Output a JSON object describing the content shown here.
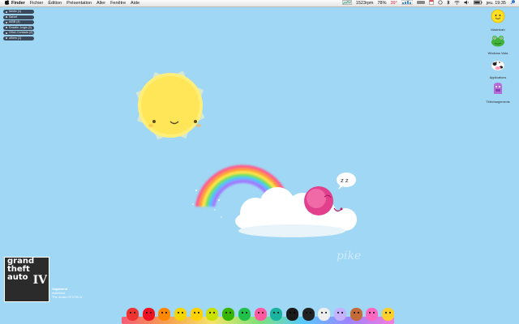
{
  "menubar": {
    "apple": "",
    "items": [
      "Finder",
      "Fichier",
      "Édition",
      "Présentation",
      "Aller",
      "Fenêtre",
      "Aide"
    ],
    "status": {
      "network": "1523rpm",
      "battery": "78%",
      "temperature": "39°",
      "clock": "jeu. 19:35"
    }
  },
  "widget_list": [
    "Ibedin (1)",
    "Salvet",
    "A/BB (4)",
    "Rosalie Jorgis (3)",
    "Other Contacts (8)",
    "others (1)"
  ],
  "desktop_icons": [
    {
      "label": "Macintosh",
      "icon": "smiley-drive-icon"
    },
    {
      "label": "Windows Vista",
      "icon": "frog-drive-icon"
    },
    {
      "label": "Applications",
      "icon": "cow-folder-icon"
    },
    {
      "label": "Téléchargements",
      "icon": "purple-folder-icon"
    }
  ],
  "wallpaper": {
    "signature": "pike",
    "sleep_bubble": "z z"
  },
  "now_playing": {
    "cover_text": "grand theft auto",
    "cover_numeral": "IV",
    "title": "Vagabond",
    "artist": "nukeseur",
    "album": "The music Of GTA IV"
  },
  "dock": {
    "items": [
      {
        "name": "ladybug",
        "color": "#e33"
      },
      {
        "name": "red-cup",
        "color": "#e12"
      },
      {
        "name": "orange",
        "color": "#f80"
      },
      {
        "name": "bee",
        "color": "#f5d400"
      },
      {
        "name": "yellow-face",
        "color": "#ffd200"
      },
      {
        "name": "lime-character",
        "color": "#c9e000"
      },
      {
        "name": "green-frog",
        "color": "#37b500"
      },
      {
        "name": "green-monster",
        "color": "#21c04c"
      },
      {
        "name": "flower",
        "color": "#ff5aa0"
      },
      {
        "name": "teal-bird",
        "color": "#19b3a0"
      },
      {
        "name": "black-cat",
        "color": "#1a1a1a"
      },
      {
        "name": "toucan",
        "color": "#222"
      },
      {
        "name": "panda",
        "color": "#eee"
      },
      {
        "name": "lavender-bunny",
        "color": "#c5b1ff"
      },
      {
        "name": "brown-girl",
        "color": "#c46b3a"
      },
      {
        "name": "pink-blob",
        "color": "#ff68c0"
      },
      {
        "name": "yellow-duck",
        "color": "#ffd02a"
      }
    ]
  }
}
